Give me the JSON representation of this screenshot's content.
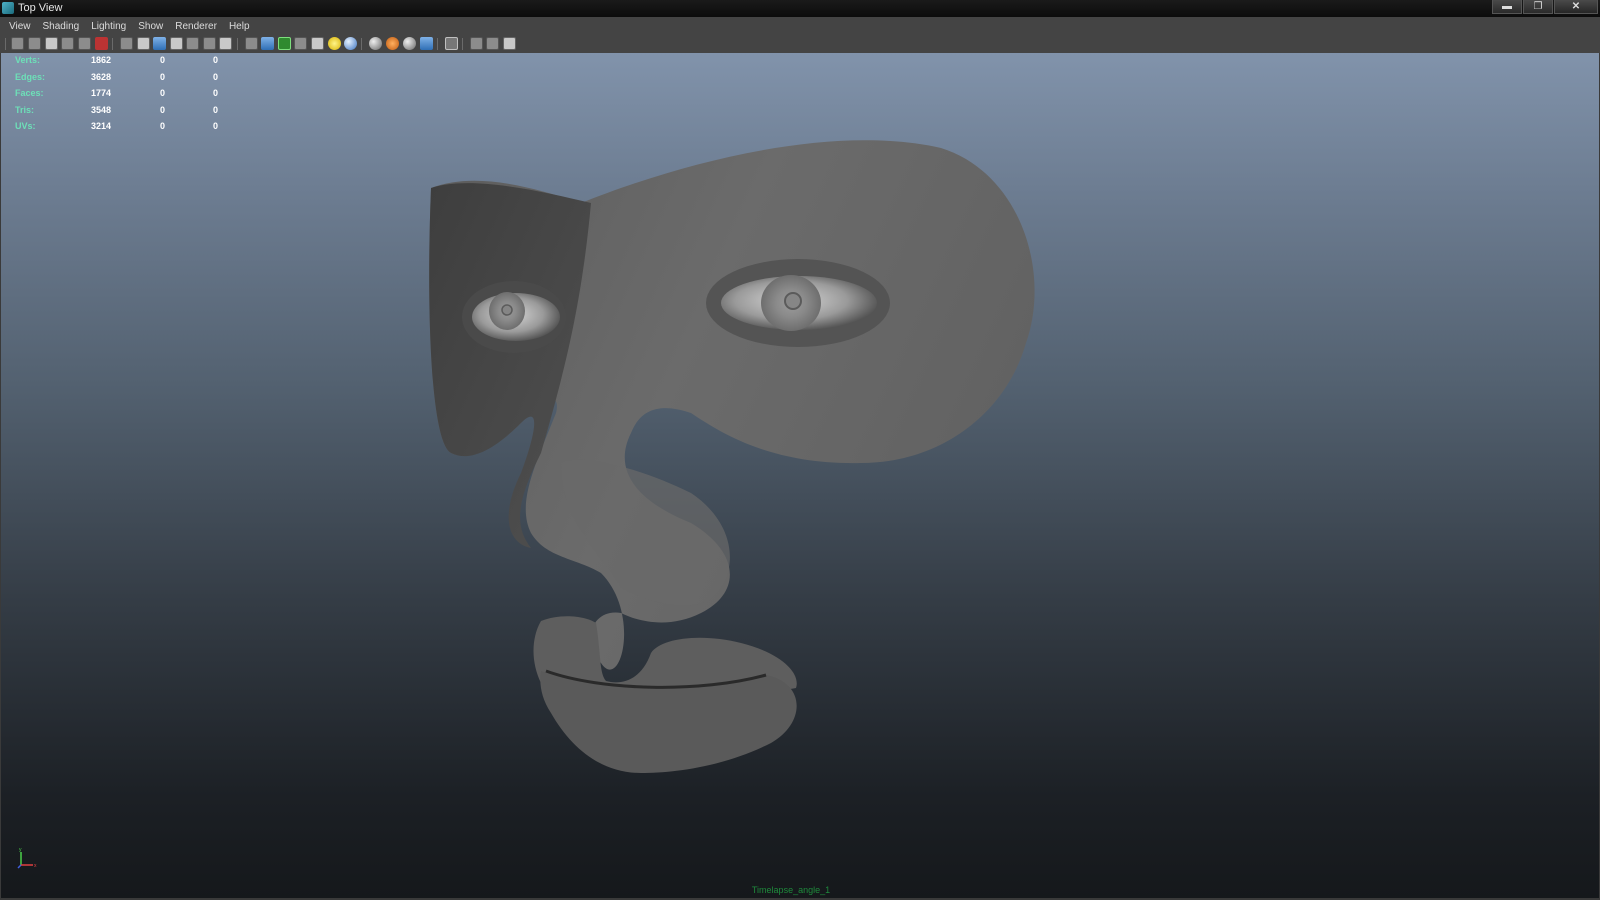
{
  "window": {
    "title": "Top View",
    "controls": {
      "minimize": "▬",
      "maximize": "❐",
      "close": "✕"
    }
  },
  "menu": [
    "View",
    "Shading",
    "Lighting",
    "Show",
    "Renderer",
    "Help"
  ],
  "toolbar_icons": [
    "select-camera-icon",
    "camera-attributes-icon",
    "bookmark-icon",
    "image-plane-icon",
    "2d-pan-zoom-icon",
    "grease-pencil-icon",
    "grid-icon",
    "film-gate-icon",
    "resolution-gate-icon",
    "gate-mask-icon",
    "field-chart-icon",
    "safe-action-icon",
    "safe-title-icon",
    "wireframe-icon",
    "smooth-shade-icon",
    "wireframe-on-shaded-icon",
    "xray-icon",
    "textured-icon",
    "use-all-lights-icon",
    "shadows-icon",
    "screen-space-ao-icon",
    "motion-blur-icon",
    "multisample-aa-icon",
    "depth-of-field-icon",
    "isolate-select-icon",
    "xray-joints-icon",
    "xray-active-icon",
    "playblast-icon"
  ],
  "heads_up": {
    "rows": [
      {
        "label": "Verts:",
        "values": [
          "1862",
          "0",
          "0"
        ]
      },
      {
        "label": "Edges:",
        "values": [
          "3628",
          "0",
          "0"
        ]
      },
      {
        "label": "Faces:",
        "values": [
          "1774",
          "0",
          "0"
        ]
      },
      {
        "label": "Tris:",
        "values": [
          "3548",
          "0",
          "0"
        ]
      },
      {
        "label": "UVs:",
        "values": [
          "3214",
          "0",
          "0"
        ]
      }
    ]
  },
  "viewport": {
    "camera_name": "Timelapse_angle_1",
    "axis": {
      "x": "x",
      "y": "y",
      "z": "z"
    }
  }
}
